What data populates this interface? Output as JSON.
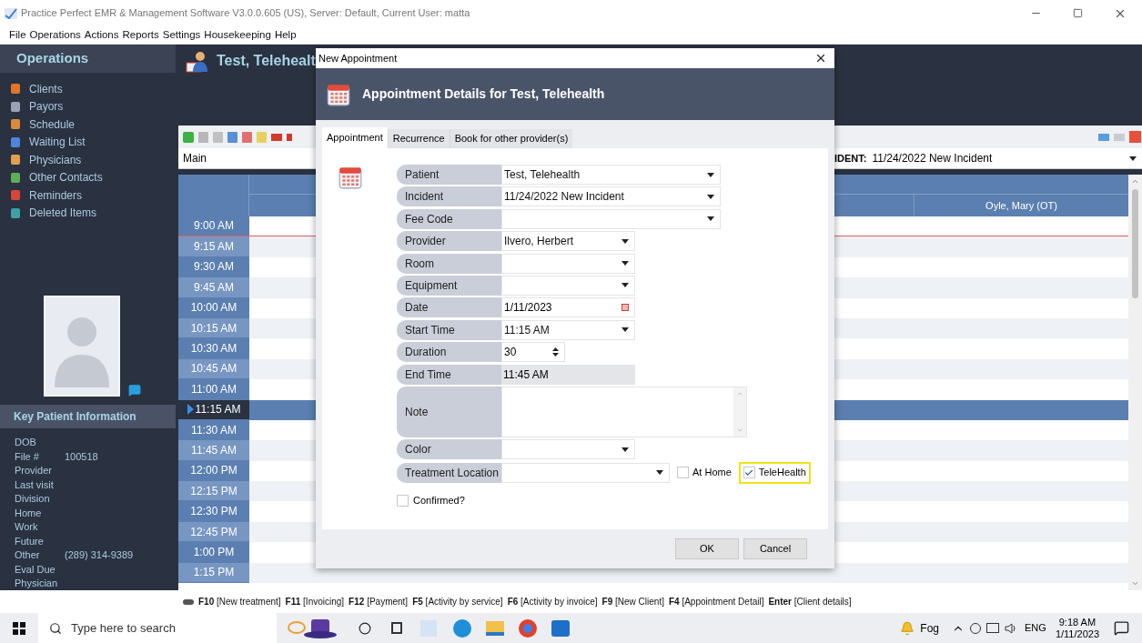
{
  "window": {
    "title": "Practice Perfect EMR & Management Software V3.0.0.605 (US), Server: Default, Current User: matta"
  },
  "menu": [
    "File",
    "Operations",
    "Actions",
    "Reports",
    "Settings",
    "Housekeeping",
    "Help"
  ],
  "sidebar": {
    "title": "Operations",
    "items": [
      "Clients",
      "Payors",
      "Schedule",
      "Waiting List",
      "Physicians",
      "Other Contacts",
      "Reminders",
      "Deleted Items"
    ],
    "key_info_title": "Key Patient Information",
    "key_info": [
      {
        "label": "DOB"
      },
      {
        "label": "File #",
        "value": "100518"
      },
      {
        "label": "Provider"
      },
      {
        "label": "Last visit"
      },
      {
        "label": "Division"
      },
      {
        "label": "Home"
      },
      {
        "label": "Work"
      },
      {
        "label": "Future"
      },
      {
        "label": "Other",
        "value": "(289) 314-9389"
      },
      {
        "label": "Eval Due"
      },
      {
        "label": "Physician"
      }
    ]
  },
  "patient_header": "Test, Telehealt",
  "view": "Main",
  "incident": {
    "label": "IDENT:",
    "value": "11/24/2022 New Incident"
  },
  "schedule": {
    "column": "Oyle, Mary (OT)",
    "times": [
      {
        "label": "9:00 AM",
        "selected": false
      },
      {
        "label": "9:15 AM",
        "selected": false
      },
      {
        "label": "9:30 AM",
        "selected": false
      },
      {
        "label": "9:45 AM",
        "selected": false
      },
      {
        "label": "10:00 AM",
        "selected": false
      },
      {
        "label": "10:15 AM",
        "selected": false
      },
      {
        "label": "10:30 AM",
        "selected": false
      },
      {
        "label": "10:45 AM",
        "selected": false
      },
      {
        "label": "11:00 AM",
        "selected": false
      },
      {
        "label": "11:15 AM",
        "selected": true
      },
      {
        "label": "11:30 AM",
        "selected": false
      },
      {
        "label": "11:45 AM",
        "selected": false
      },
      {
        "label": "12:00 PM",
        "selected": false
      },
      {
        "label": "12:15 PM",
        "selected": false
      },
      {
        "label": "12:30 PM",
        "selected": false
      },
      {
        "label": "12:45 PM",
        "selected": false
      },
      {
        "label": "1:00 PM",
        "selected": false
      },
      {
        "label": "1:15 PM",
        "selected": false
      }
    ]
  },
  "shortcuts": [
    {
      "key": "F10",
      "label": "[New treatment]"
    },
    {
      "key": "F11",
      "label": "[Invoicing]"
    },
    {
      "key": "F12",
      "label": "[Payment]"
    },
    {
      "key": "F5",
      "label": "[Activity by service]"
    },
    {
      "key": "F6",
      "label": "[Activity by invoice]"
    },
    {
      "key": "F9",
      "label": "[New Client]"
    },
    {
      "key": "F4",
      "label": "[Appointment Detail]"
    },
    {
      "key": "Enter",
      "label": "[Client details]"
    }
  ],
  "dialog": {
    "title": "New Appointment",
    "header": "Appointment Details for Test, Telehealth",
    "tabs": [
      {
        "label": "Appointment",
        "selected": true
      },
      {
        "label": "Recurrence",
        "selected": false
      },
      {
        "label": "Book for other provider(s)",
        "selected": false
      }
    ],
    "fields": [
      {
        "label": "Patient",
        "kind": "combobox",
        "value": "Test, Telehealth"
      },
      {
        "label": "Incident",
        "kind": "combobox",
        "value": "11/24/2022 New Incident"
      },
      {
        "label": "Fee Code",
        "kind": "combobox"
      },
      {
        "label": "Provider",
        "kind": "dropdown",
        "value": "Ilvero, Herbert"
      },
      {
        "label": "Room",
        "kind": "dropdown"
      },
      {
        "label": "Equipment",
        "kind": "dropdown"
      },
      {
        "label": "Date",
        "kind": "date",
        "value": "1/11/2023"
      },
      {
        "label": "Start Time",
        "kind": "dropdown",
        "value": "11:15 AM"
      },
      {
        "label": "Duration",
        "kind": "spinner",
        "value": "30"
      },
      {
        "label": "End Time",
        "kind": "readonly",
        "value": "11:45 AM"
      },
      {
        "label": "Note",
        "kind": "textarea"
      },
      {
        "label": "Color",
        "kind": "dropdown"
      },
      {
        "label": "Treatment Location",
        "kind": "location"
      }
    ],
    "location_options": [
      {
        "label": "At Home",
        "checked": false,
        "highlighted": false
      },
      {
        "label": "TeleHealth",
        "checked": true,
        "highlighted": true
      }
    ],
    "confirmed": {
      "label": "Confirmed?",
      "checked": false
    },
    "buttons": [
      "OK",
      "Cancel"
    ]
  },
  "taskbar": {
    "search_placeholder": "Type here to search",
    "weather": "Fog",
    "language": "ENG",
    "time": "9:18 AM",
    "date": "1/11/2023"
  }
}
